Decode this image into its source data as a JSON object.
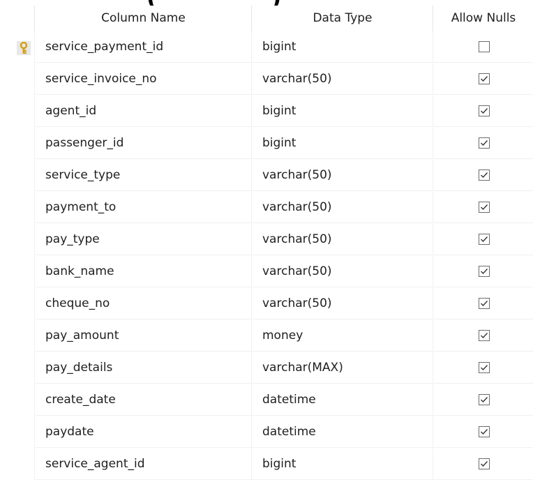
{
  "window_title_fragment": "(_________)",
  "table_designer": {
    "columns_header": {
      "column_name": "Column Name",
      "data_type": "Data Type",
      "allow_nulls": "Allow Nulls"
    },
    "rows": [
      {
        "name": "service_payment_id",
        "type": "bigint",
        "allow_nulls": false,
        "primary_key": true
      },
      {
        "name": "service_invoice_no",
        "type": "varchar(50)",
        "allow_nulls": true,
        "primary_key": false
      },
      {
        "name": "agent_id",
        "type": "bigint",
        "allow_nulls": true,
        "primary_key": false
      },
      {
        "name": "passenger_id",
        "type": "bigint",
        "allow_nulls": true,
        "primary_key": false
      },
      {
        "name": "service_type",
        "type": "varchar(50)",
        "allow_nulls": true,
        "primary_key": false
      },
      {
        "name": "payment_to",
        "type": "varchar(50)",
        "allow_nulls": true,
        "primary_key": false
      },
      {
        "name": "pay_type",
        "type": "varchar(50)",
        "allow_nulls": true,
        "primary_key": false
      },
      {
        "name": "bank_name",
        "type": "varchar(50)",
        "allow_nulls": true,
        "primary_key": false
      },
      {
        "name": "cheque_no",
        "type": "varchar(50)",
        "allow_nulls": true,
        "primary_key": false
      },
      {
        "name": "pay_amount",
        "type": "money",
        "allow_nulls": true,
        "primary_key": false
      },
      {
        "name": "pay_details",
        "type": "varchar(MAX)",
        "allow_nulls": true,
        "primary_key": false
      },
      {
        "name": "create_date",
        "type": "datetime",
        "allow_nulls": true,
        "primary_key": false
      },
      {
        "name": "paydate",
        "type": "datetime",
        "allow_nulls": true,
        "primary_key": false
      },
      {
        "name": "service_agent_id",
        "type": "bigint",
        "allow_nulls": true,
        "primary_key": false
      }
    ],
    "icons": {
      "primary_key": "key-icon",
      "checked": "checkbox-checked-icon",
      "unchecked": "checkbox-unchecked-icon"
    },
    "colors": {
      "key_icon": "#d4a017",
      "checkbox_border": "#6b6b6b",
      "key_cell_bg": "#e8e8e8"
    }
  }
}
